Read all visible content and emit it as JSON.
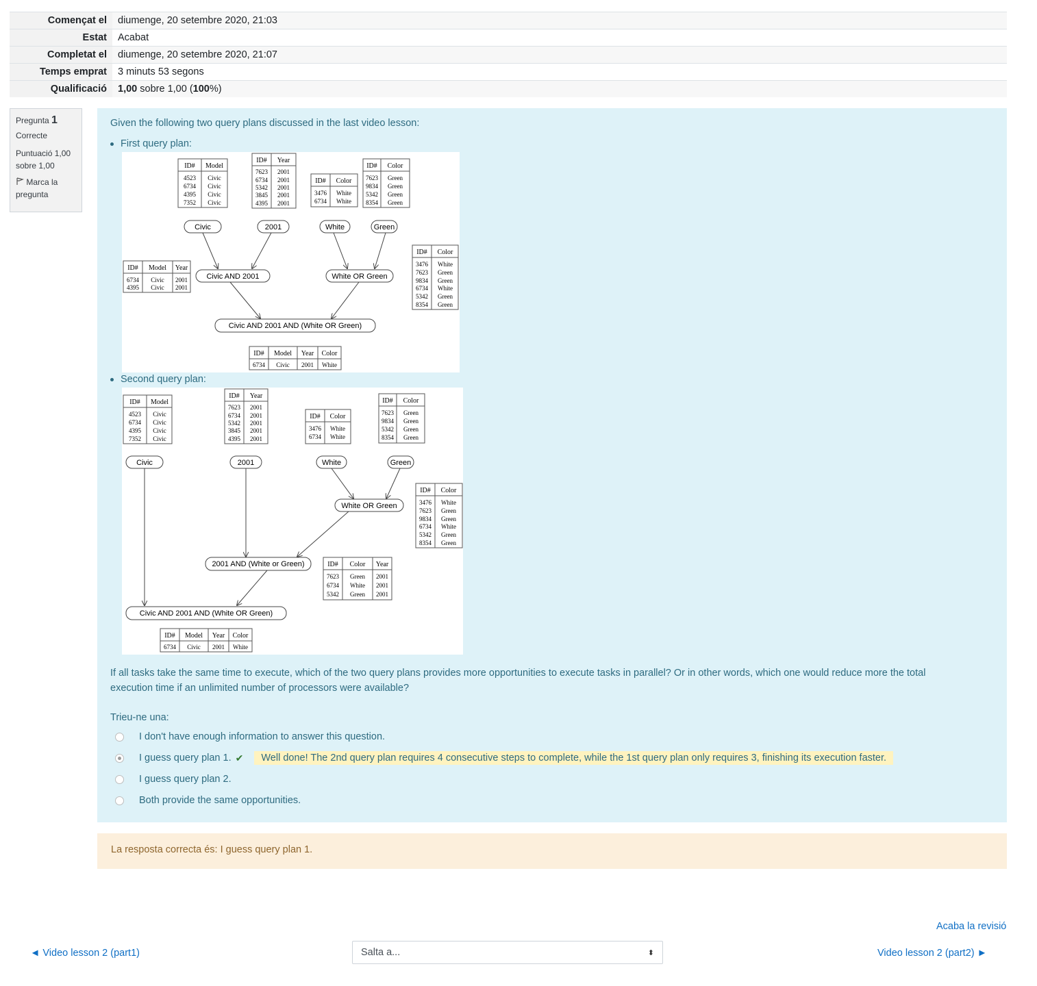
{
  "summary": [
    {
      "label": "Començat el",
      "value": "diumenge, 20 setembre 2020, 21:03"
    },
    {
      "label": "Estat",
      "value": "Acabat"
    },
    {
      "label": "Completat el",
      "value": "diumenge, 20 setembre 2020, 21:07"
    },
    {
      "label": "Temps emprat",
      "value": "3 minuts 53 segons"
    },
    {
      "label": "Qualificació",
      "grade": "1,00",
      "sobre": " sobre 1,00 (",
      "pct": "100",
      "pct_suffix": "%)"
    }
  ],
  "info": {
    "pregunta_label": "Pregunta",
    "pregunta_num": "1",
    "state": "Correcte",
    "grade": "Puntuació 1,00 sobre 1,00",
    "flag": "Marca la pregunta"
  },
  "question": {
    "intro": "Given the following two query plans discussed in the last video lesson:",
    "first": "First query plan:",
    "second": "Second query plan:",
    "body": "If all tasks take the same time to execute, which of the two query plans provides more opportunities to execute tasks in parallel? Or in other words, which one would reduce more the total execution time if an unlimited number of processors were available?",
    "prompt": "Trieu-ne una:",
    "options": [
      {
        "label": "I don't have enough information to answer this question.",
        "checked": false
      },
      {
        "label": "I guess query plan 1.",
        "checked": true,
        "feedback": "Well done! The 2nd query plan requires 4 consecutive steps to complete, while the 1st query plan only requires 3, finishing its execution faster."
      },
      {
        "label": "I guess query plan 2.",
        "checked": false
      },
      {
        "label": "Both provide the same opportunities.",
        "checked": false
      }
    ],
    "right_answer": "La resposta correcta és: I guess query plan 1."
  },
  "plan1": {
    "nodes": {
      "civic": "Civic",
      "y2001": "2001",
      "white": "White",
      "green": "Green",
      "and1": "Civic AND 2001",
      "or1": "White OR Green",
      "final": "Civic AND 2001 AND (White OR Green)"
    },
    "tables": {
      "model_hdr": [
        "ID#",
        "Model"
      ],
      "model_rows": [
        [
          "4523",
          "Civic"
        ],
        [
          "6734",
          "Civic"
        ],
        [
          "4395",
          "Civic"
        ],
        [
          "7352",
          "Civic"
        ]
      ],
      "year_hdr": [
        "ID#",
        "Year"
      ],
      "year_rows": [
        [
          "7623",
          "2001"
        ],
        [
          "6734",
          "2001"
        ],
        [
          "5342",
          "2001"
        ],
        [
          "3845",
          "2001"
        ],
        [
          "4395",
          "2001"
        ]
      ],
      "white_hdr": [
        "ID#",
        "Color"
      ],
      "white_rows": [
        [
          "3476",
          "White"
        ],
        [
          "6734",
          "White"
        ]
      ],
      "green_hdr": [
        "ID#",
        "Color"
      ],
      "green_rows": [
        [
          "7623",
          "Green"
        ],
        [
          "9834",
          "Green"
        ],
        [
          "5342",
          "Green"
        ],
        [
          "8354",
          "Green"
        ]
      ],
      "and_hdr": [
        "ID#",
        "Model",
        "Year"
      ],
      "and_rows": [
        [
          "6734",
          "Civic",
          "2001"
        ],
        [
          "4395",
          "Civic",
          "2001"
        ]
      ],
      "or_hdr": [
        "ID#",
        "Color"
      ],
      "or_rows": [
        [
          "3476",
          "White"
        ],
        [
          "7623",
          "Green"
        ],
        [
          "9834",
          "Green"
        ],
        [
          "6734",
          "White"
        ],
        [
          "5342",
          "Green"
        ],
        [
          "8354",
          "Green"
        ]
      ],
      "final_hdr": [
        "ID#",
        "Model",
        "Year",
        "Color"
      ],
      "final_rows": [
        [
          "6734",
          "Civic",
          "2001",
          "White"
        ]
      ]
    }
  },
  "plan2": {
    "nodes": {
      "civic": "Civic",
      "y2001": "2001",
      "white": "White",
      "green": "Green",
      "or1": "White OR Green",
      "and2": "2001 AND (White or Green)",
      "final": "Civic AND 2001 AND (White OR Green)"
    },
    "tables": {
      "mid_hdr": [
        "ID#",
        "Color",
        "Year"
      ],
      "mid_rows": [
        [
          "7623",
          "Green",
          "2001"
        ],
        [
          "6734",
          "White",
          "2001"
        ],
        [
          "5342",
          "Green",
          "2001"
        ]
      ]
    }
  },
  "nav": {
    "finish": "Acaba la revisió",
    "prev": "◄ Video lesson 2 (part1)",
    "jump": "Salta a...",
    "next": "Video lesson 2 (part2) ►"
  }
}
